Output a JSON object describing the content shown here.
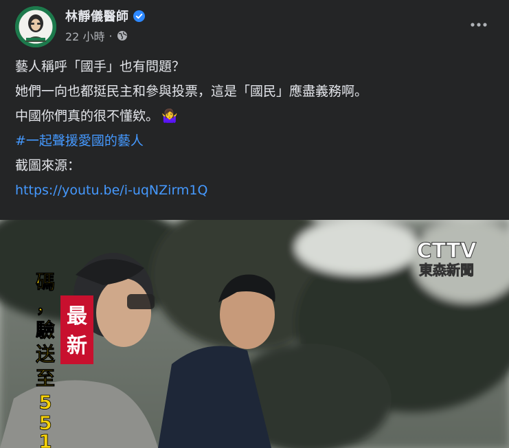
{
  "author": {
    "name": "林靜儀醫師"
  },
  "meta": {
    "time": "22 小時",
    "separator": "·"
  },
  "post": {
    "line1": "藝人稱呼「國手」也有問題？",
    "line2": "她們一向也都挺民主和參與投票，這是「國民」應盡義務啊。",
    "line3": "中國你們真的很不懂欸。",
    "line3_emoji": "🤷‍♀️",
    "hashtag": "#一起聲援愛國的藝人",
    "source_label": "截圖來源：",
    "link": "https://youtu.be/i-uqNZirm1Q"
  },
  "video": {
    "logo": "CTTV",
    "station": "東森新聞",
    "badge": "最新",
    "side_text": "碼，驗送至551"
  },
  "colors": {
    "background": "#242526",
    "text": "#e4e6eb",
    "secondary": "#b0b3b8",
    "link": "#4599ff",
    "verified": "#2d88ff",
    "badge_red": "#c8102e"
  }
}
